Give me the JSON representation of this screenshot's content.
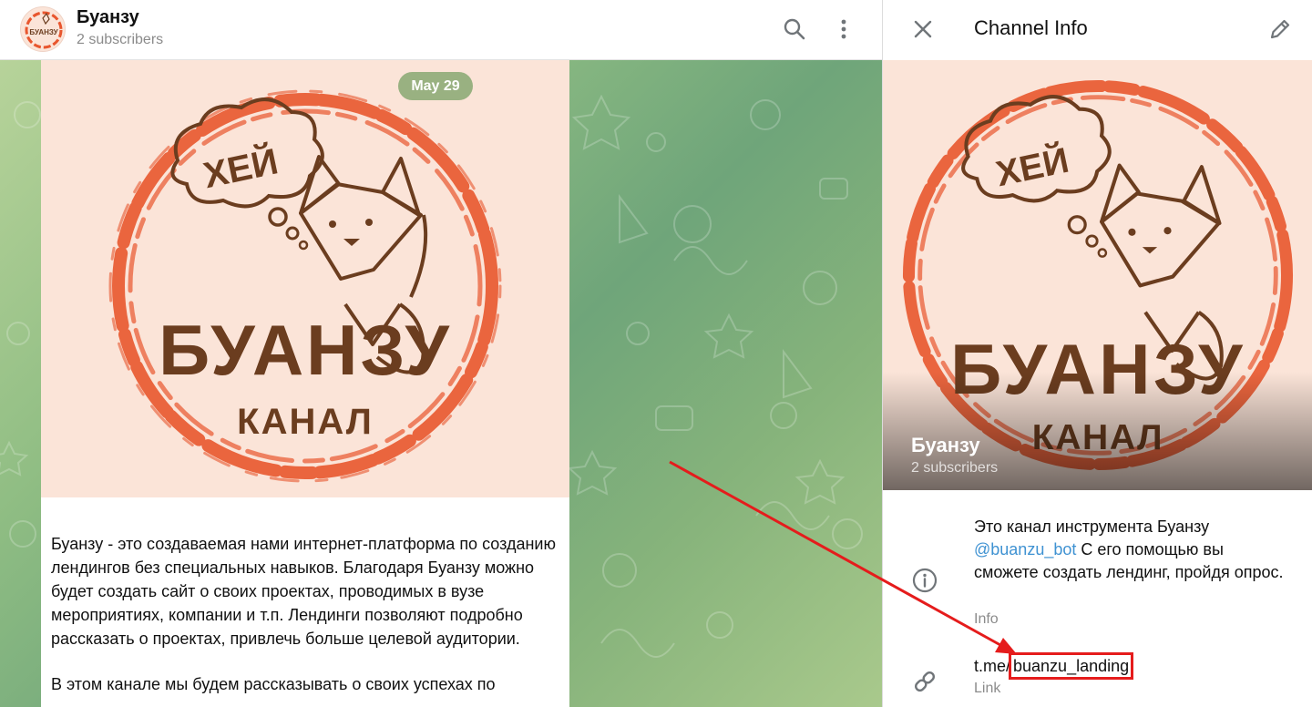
{
  "chat_header": {
    "title": "Буанзу",
    "subtitle": "2 subscribers"
  },
  "post": {
    "date": "May 29",
    "logo": {
      "bubble_text": "ХЕЙ",
      "brand": "БУАНЗУ",
      "sub": "КАНАЛ"
    },
    "paragraphs": [
      "Буанзу - это создаваемая нами интернет-платформа по созданию лендингов без специальных навыков. Благодаря Буанзу можно будет создать сайт о своих проектах, проводимых в вузе мероприятиях, компании и т.п. Лендинги позволяют подробно рассказать о проектах, привлечь больше целевой аудитории.",
      "В этом канале мы будем рассказывать о своих успехах по"
    ]
  },
  "info_panel": {
    "title": "Channel Info",
    "name": "Буанзу",
    "subscribers": "2 subscribers",
    "description_before": "Это канал инструмента Буанзу ",
    "description_mention": "@buanzu_bot",
    "description_after": " С его помощью вы сможете создать лендинг, пройдя опрос.",
    "info_label": "Info",
    "link_prefix": "t.me/",
    "link_handle": "buanzu_landing",
    "link_label": "Link"
  },
  "icons": {
    "search": "search-icon",
    "more": "more-vertical-icon",
    "close": "close-icon",
    "edit": "pencil-icon",
    "info": "info-icon",
    "link": "link-icon"
  },
  "colors": {
    "accent_link": "#3f92d2",
    "highlight": "#e51c1c",
    "logo_brown": "#6b3d1f",
    "logo_ring": "#e8562e",
    "logo_bg": "#fbe4d8",
    "date_pill": "#8cb07a"
  }
}
